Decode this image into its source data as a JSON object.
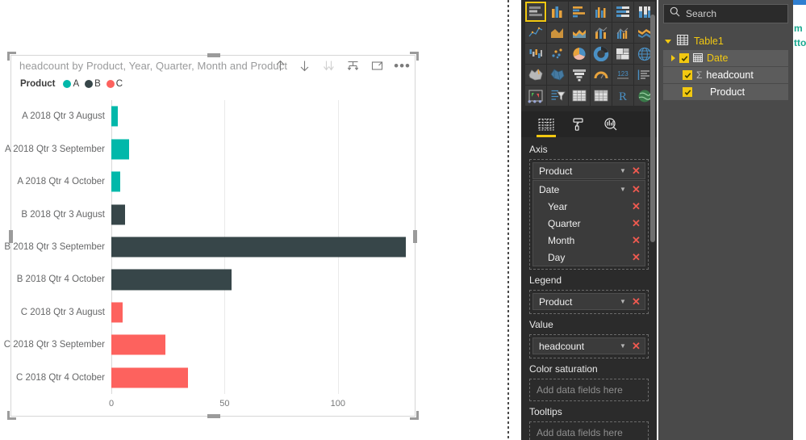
{
  "visual": {
    "title": "headcount by Product, Year, Quarter, Month and Product",
    "legend_title": "Product",
    "toolbar": {
      "drill_up": "drill-up",
      "drill_down": "drill-down",
      "expand_all": "expand-all",
      "drill_mode": "drill-mode",
      "focus_mode": "focus-mode",
      "more_options": "•••"
    }
  },
  "chart_data": {
    "type": "bar",
    "orientation": "horizontal",
    "title": "headcount by Product, Year, Quarter, Month and Product",
    "xlabel": "",
    "ylabel": "",
    "xlim": [
      0,
      130
    ],
    "xticks": [
      0,
      50,
      100
    ],
    "xtick_labels": [
      "0",
      "50",
      "100"
    ],
    "grid": true,
    "legend_position": "top-left",
    "legend_title": "Product",
    "legend": [
      {
        "name": "A",
        "color": "#01b8aa"
      },
      {
        "name": "B",
        "color": "#374649"
      },
      {
        "name": "C",
        "color": "#fd625e"
      }
    ],
    "categories": [
      "A 2018 Qtr 3 August",
      "A 2018 Qtr 3 September",
      "A 2018 Qtr 4 October",
      "B 2018 Qtr 3 August",
      "B 2018 Qtr 3 September",
      "B 2018 Qtr 4 October",
      "C 2018 Qtr 3 August",
      "C 2018 Qtr 3 September",
      "C 2018 Qtr 4 October"
    ],
    "values": [
      3,
      8,
      4,
      6,
      130,
      53,
      5,
      24,
      34
    ],
    "bar_colors": [
      "#01b8aa",
      "#01b8aa",
      "#01b8aa",
      "#374649",
      "#374649",
      "#374649",
      "#fd625e",
      "#fd625e",
      "#fd625e"
    ],
    "series": [
      {
        "name": "A",
        "color": "#01b8aa",
        "categories": [
          "A 2018 Qtr 3 August",
          "A 2018 Qtr 3 September",
          "A 2018 Qtr 4 October"
        ],
        "values": [
          3,
          8,
          4
        ]
      },
      {
        "name": "B",
        "color": "#374649",
        "categories": [
          "B 2018 Qtr 3 August",
          "B 2018 Qtr 3 September",
          "B 2018 Qtr 4 October"
        ],
        "values": [
          6,
          130,
          53
        ]
      },
      {
        "name": "C",
        "color": "#fd625e",
        "categories": [
          "C 2018 Qtr 3 August",
          "C 2018 Qtr 3 September",
          "C 2018 Qtr 4 October"
        ],
        "values": [
          5,
          24,
          34
        ]
      }
    ]
  },
  "viz_pane": {
    "gallery": [
      "stacked-bar-chart",
      "stacked-column-chart",
      "clustered-bar-chart",
      "clustered-column-chart",
      "100-percent-stacked-bar-chart",
      "100-percent-stacked-column-chart",
      "line-chart",
      "area-chart",
      "stacked-area-chart",
      "line-and-stacked-column-chart",
      "line-and-clustered-column-chart",
      "ribbon-chart",
      "waterfall-chart",
      "scatter-chart",
      "pie-chart",
      "donut-chart",
      "treemap",
      "map",
      "filled-map",
      "shape-map",
      "funnel",
      "gauge",
      "card",
      "multi-row-card",
      "kpi",
      "slicer",
      "table",
      "matrix",
      "r-script-visual",
      "arcgis-map"
    ],
    "selected_index": 0,
    "more_visuals": "•••",
    "tabs": [
      {
        "name": "fields-tab",
        "icon": "fields-icon",
        "active": true
      },
      {
        "name": "format-tab",
        "icon": "paint-roller-icon",
        "active": false
      },
      {
        "name": "analytics-tab",
        "icon": "magnifier-chart-icon",
        "active": false
      }
    ],
    "wells": [
      {
        "title": "Axis",
        "chips": [
          {
            "label": "Product",
            "caret": true,
            "remove": "✕",
            "children": []
          },
          {
            "label": "Date",
            "caret": true,
            "remove": "✕",
            "children": [
              {
                "label": "Year",
                "remove": "✕"
              },
              {
                "label": "Quarter",
                "remove": "✕"
              },
              {
                "label": "Month",
                "remove": "✕"
              },
              {
                "label": "Day",
                "remove": "✕"
              }
            ]
          }
        ]
      },
      {
        "title": "Legend",
        "chips": [
          {
            "label": "Product",
            "caret": true,
            "remove": "✕",
            "children": []
          }
        ]
      },
      {
        "title": "Value",
        "chips": [
          {
            "label": "headcount",
            "caret": true,
            "remove": "✕",
            "children": []
          }
        ]
      },
      {
        "title": "Color saturation",
        "placeholder": "Add data fields here",
        "chips": []
      },
      {
        "title": "Tooltips",
        "placeholder": "Add data fields here",
        "chips": []
      }
    ]
  },
  "fields_pane": {
    "search_placeholder": "Search",
    "search_value": "Search",
    "search_icon": "search-icon",
    "table": {
      "name": "Table1",
      "expanded": true,
      "icon": "table-icon"
    },
    "fields": [
      {
        "name": "Date",
        "checked": true,
        "icon": "calendar-icon",
        "expandable": true,
        "indent": 1,
        "color": "yellow"
      },
      {
        "name": "headcount",
        "checked": true,
        "icon": "sigma-icon",
        "expandable": false,
        "indent": 2,
        "color": "white"
      },
      {
        "name": "Product",
        "checked": true,
        "icon": "none",
        "expandable": false,
        "indent": 2,
        "color": "white"
      }
    ]
  },
  "sliver": {
    "line1": "m",
    "line2": "tto"
  }
}
